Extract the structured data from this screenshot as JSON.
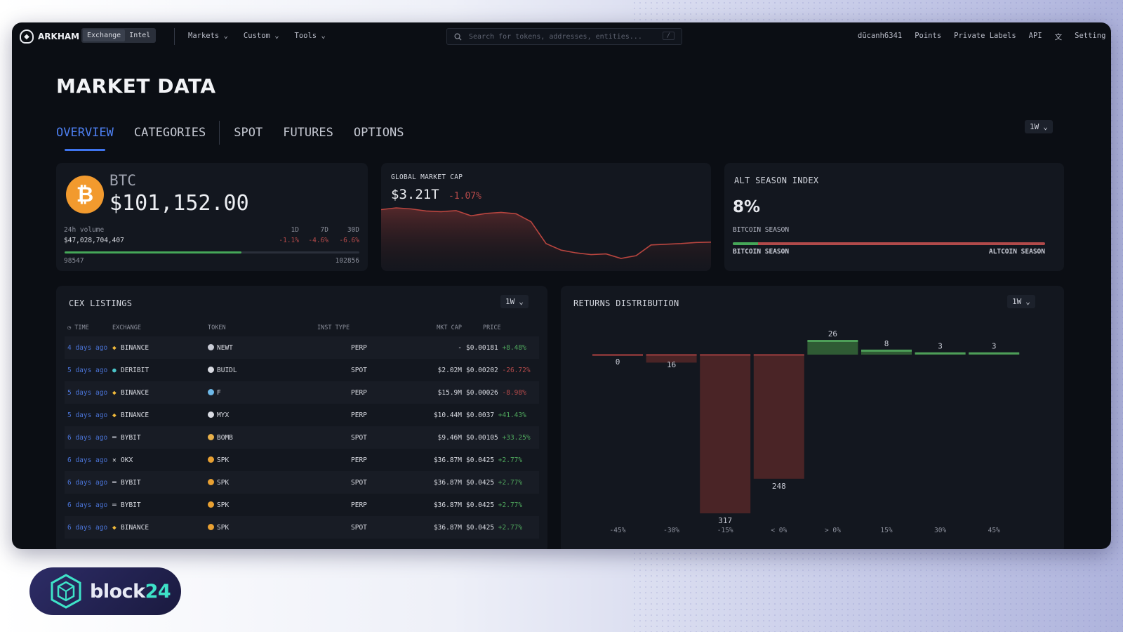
{
  "topbar": {
    "brand": "ARKHAM",
    "toggle": [
      "Exchange",
      "Intel"
    ],
    "menu": [
      "Markets",
      "Custom",
      "Tools"
    ],
    "search_placeholder": "Search for tokens, addresses, entities...",
    "search_shortcut": "/",
    "right": [
      "dũcanh6341",
      "Points",
      "Private Labels",
      "API",
      "Setting"
    ]
  },
  "page": {
    "title": "MARKET DATA",
    "tabs": [
      "OVERVIEW",
      "CATEGORIES",
      "SPOT",
      "FUTURES",
      "OPTIONS"
    ],
    "active_tab": "OVERVIEW",
    "period": "1W"
  },
  "btc_card": {
    "symbol": "BTC",
    "price": "$101,152.00",
    "volume_label": "24h volume",
    "volume_value": "$47,028,704,407",
    "periods": [
      "1D",
      "7D",
      "30D"
    ],
    "changes": [
      "-1.1%",
      "-4.6%",
      "-6.6%"
    ],
    "range_low": "98547",
    "range_high": "102856",
    "range_position": 0.6
  },
  "market_cap": {
    "title": "GLOBAL MARKET CAP",
    "value": "$3.21T",
    "change": "-1.07%",
    "series": [
      3.37,
      3.375,
      3.372,
      3.366,
      3.364,
      3.367,
      3.352,
      3.359,
      3.362,
      3.358,
      3.335,
      3.272,
      3.253,
      3.245,
      3.24,
      3.242,
      3.229,
      3.237,
      3.268,
      3.27,
      3.272,
      3.275,
      3.276
    ]
  },
  "alt_season": {
    "title": "ALT SEASON INDEX",
    "value": "8%",
    "status": "BITCOIN SEASON",
    "left_label": "BITCOIN SEASON",
    "right_label": "ALTCOIN SEASON",
    "fraction": 0.08
  },
  "cex": {
    "title": "CEX LISTINGS",
    "period": "1W",
    "columns": [
      "TIME",
      "EXCHANGE",
      "TOKEN",
      "INST TYPE",
      "MKT CAP",
      "PRICE"
    ],
    "rows": [
      {
        "time": "4 days ago",
        "exchange": "BINANCE",
        "token": "NEWT",
        "type": "PERP",
        "mcap": "-",
        "price": "$0.00181",
        "change": "+8.48%",
        "dir": "pos",
        "ex_icon": "binance-icon",
        "tok_color": "#c9ccd6"
      },
      {
        "time": "5 days ago",
        "exchange": "DERIBIT",
        "token": "BUIDL",
        "type": "SPOT",
        "mcap": "$2.02M",
        "price": "$0.00202",
        "change": "-26.72%",
        "dir": "neg",
        "ex_icon": "deribit-icon",
        "tok_color": "#d9dbe2"
      },
      {
        "time": "5 days ago",
        "exchange": "BINANCE",
        "token": "F",
        "type": "PERP",
        "mcap": "$15.9M",
        "price": "$0.00026",
        "change": "-8.98%",
        "dir": "neg",
        "ex_icon": "binance-icon",
        "tok_color": "#6db8e8"
      },
      {
        "time": "5 days ago",
        "exchange": "BINANCE",
        "token": "MYX",
        "type": "PERP",
        "mcap": "$10.44M",
        "price": "$0.0037",
        "change": "+41.43%",
        "dir": "pos",
        "ex_icon": "binance-icon",
        "tok_color": "#d9dbe2"
      },
      {
        "time": "6 days ago",
        "exchange": "BYBIT",
        "token": "BOMB",
        "type": "SPOT",
        "mcap": "$9.46M",
        "price": "$0.00105",
        "change": "+33.25%",
        "dir": "pos",
        "ex_icon": "bybit-icon",
        "tok_color": "#e8b04a"
      },
      {
        "time": "6 days ago",
        "exchange": "OKX",
        "token": "SPK",
        "type": "PERP",
        "mcap": "$36.87M",
        "price": "$0.0425",
        "change": "+2.77%",
        "dir": "pos",
        "ex_icon": "okx-icon",
        "tok_color": "#e8a032"
      },
      {
        "time": "6 days ago",
        "exchange": "BYBIT",
        "token": "SPK",
        "type": "SPOT",
        "mcap": "$36.87M",
        "price": "$0.0425",
        "change": "+2.77%",
        "dir": "pos",
        "ex_icon": "bybit-icon",
        "tok_color": "#e8a032"
      },
      {
        "time": "6 days ago",
        "exchange": "BYBIT",
        "token": "SPK",
        "type": "PERP",
        "mcap": "$36.87M",
        "price": "$0.0425",
        "change": "+2.77%",
        "dir": "pos",
        "ex_icon": "bybit-icon",
        "tok_color": "#e8a032"
      },
      {
        "time": "6 days ago",
        "exchange": "BINANCE",
        "token": "SPK",
        "type": "SPOT",
        "mcap": "$36.87M",
        "price": "$0.0425",
        "change": "+2.77%",
        "dir": "pos",
        "ex_icon": "binance-icon",
        "tok_color": "#e8a032"
      }
    ]
  },
  "returns": {
    "title": "RETURNS DISTRIBUTION",
    "period": "1W"
  },
  "chart_data": {
    "type": "bar",
    "title": "RETURNS DISTRIBUTION",
    "categories": [
      "-45%",
      "-30%",
      "-15%",
      "< 0%",
      "> 0%",
      "15%",
      "30%",
      "45%"
    ],
    "values": [
      0,
      16,
      317,
      248,
      26,
      8,
      3,
      3
    ],
    "direction": [
      "down",
      "down",
      "down",
      "down",
      "up",
      "up",
      "up",
      "up"
    ],
    "colors": {
      "down": "#4a2426",
      "up": "#2f5b34",
      "down_line": "#7a3335",
      "up_line": "#4d9e58"
    },
    "legend": "none",
    "grid": false
  },
  "footer": {
    "brand_pre": "block",
    "brand_post": "24"
  }
}
